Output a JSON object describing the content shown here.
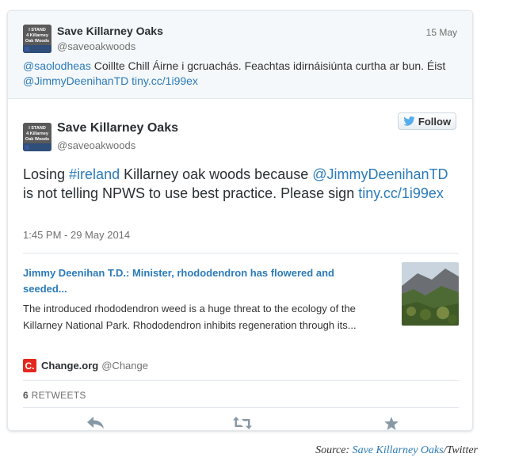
{
  "reply_tweet": {
    "name": "Save Killarney Oaks",
    "handle": "@saveoakwoods",
    "date": "15 May",
    "mention": "@saolodheas",
    "text_part1": " Coillte Chill Áirne i gcruachás. Feachtas idirnáisiúnta curtha ar bun. Éist ",
    "mention2": "@JimmyDeenihanTD",
    "link": "tiny.cc/1i99ex"
  },
  "avatar": {
    "lines": [
      "I STAND",
      "4 Killarney",
      "Oak Woods"
    ]
  },
  "main_tweet": {
    "name": "Save Killarney Oaks",
    "handle": "@saveoakwoods",
    "follow_label": "Follow",
    "text_part1": "Losing ",
    "hashtag": "#ireland",
    "text_part2": " Killarney oak woods because ",
    "mention": "@JimmyDeenihanTD",
    "text_part3": " is not telling NPWS to use best practice. Please sign ",
    "link": "tiny.cc/1i99ex",
    "timestamp": "1:45 PM - 29 May 2014"
  },
  "summary_card": {
    "title": "Jimmy Deenihan T.D.: Minister, rhododendron has flowered and seeded...",
    "description": "The introduced rhododendron weed is a huge threat to the ecology of the Killarney National Park.  Rhododendron inhibits regeneration through its...",
    "source_logo": "C.",
    "source_name": "Change.org",
    "source_handle": "@Change"
  },
  "stats": {
    "retweet_count": "6",
    "retweet_label": "RETWEETS"
  },
  "actions": {
    "icons": [
      "reply-icon",
      "retweet-icon",
      "favorite-icon"
    ]
  },
  "colors": {
    "link": "#2b7bb9",
    "twitter_bird": "#55acee",
    "change_logo": "#e3281e"
  },
  "caption": {
    "prefix": "Source: ",
    "link": "Save Killarney Oaks",
    "suffix": "/Twitter"
  }
}
